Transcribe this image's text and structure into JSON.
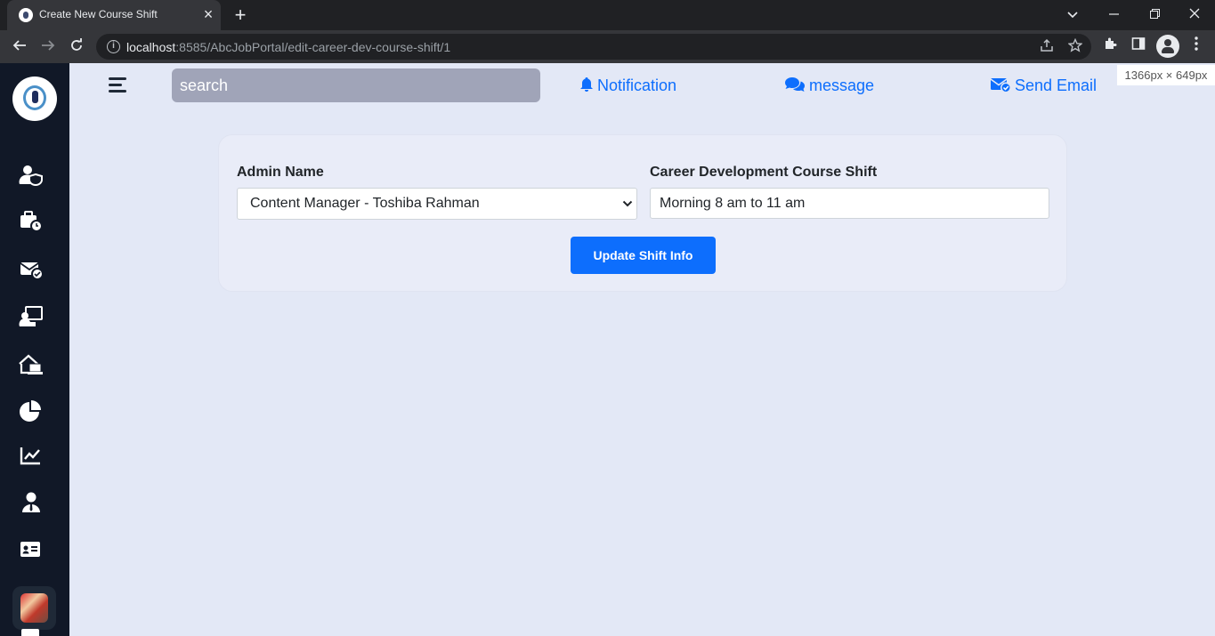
{
  "browser": {
    "tab_title": "Create New Course Shift",
    "url_host": "localhost",
    "url_rest": ":8585/AbcJobPortal/edit-career-dev-course-shift/1",
    "size_badge": "1366px × 649px"
  },
  "sidebar": {
    "items": [
      {
        "icon": "user-shield-icon"
      },
      {
        "icon": "briefcase-clock-icon"
      },
      {
        "icon": "envelope-check-icon"
      },
      {
        "icon": "chalkboard-teacher-icon"
      },
      {
        "icon": "house-laptop-icon"
      },
      {
        "icon": "pie-chart-icon"
      },
      {
        "icon": "line-chart-icon"
      },
      {
        "icon": "user-tie-icon"
      },
      {
        "icon": "id-card-icon"
      }
    ]
  },
  "header": {
    "search_placeholder": "search",
    "notification_label": "Notification",
    "message_label": "message",
    "send_email_label": "Send Email"
  },
  "form": {
    "admin_label": "Admin Name",
    "admin_selected": "Content Manager - Toshiba Rahman",
    "shift_label": "Career Development Course Shift",
    "shift_value": "Morning 8 am to 11 am",
    "submit_label": "Update Shift Info"
  },
  "colors": {
    "accent": "#0d6efd",
    "sidebar_bg": "#111827",
    "page_bg": "#e3e8f6"
  }
}
